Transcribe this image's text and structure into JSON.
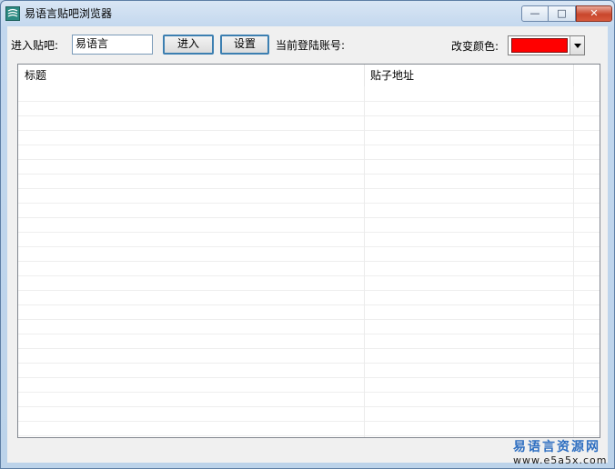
{
  "window": {
    "title": "易语言贴吧浏览器"
  },
  "caption_buttons": {
    "minimize": "—",
    "maximize": "□",
    "close": "✕"
  },
  "toolbar": {
    "enter_label": "进入贴吧:",
    "bar_input_value": "易语言",
    "enter_button": "进入",
    "settings_button": "设置",
    "account_label": "当前登陆账号:",
    "account_value": "",
    "color_label": "改变颜色:",
    "color_value": "#ff0000"
  },
  "table": {
    "columns": [
      "标题",
      "贴子地址"
    ],
    "rows": []
  },
  "watermark": {
    "line1": "易语言资源网",
    "line2": "www.e5a5x.com"
  },
  "colors": {
    "selected_color": "#ff0000",
    "header_accent": "#3c7fb1"
  }
}
